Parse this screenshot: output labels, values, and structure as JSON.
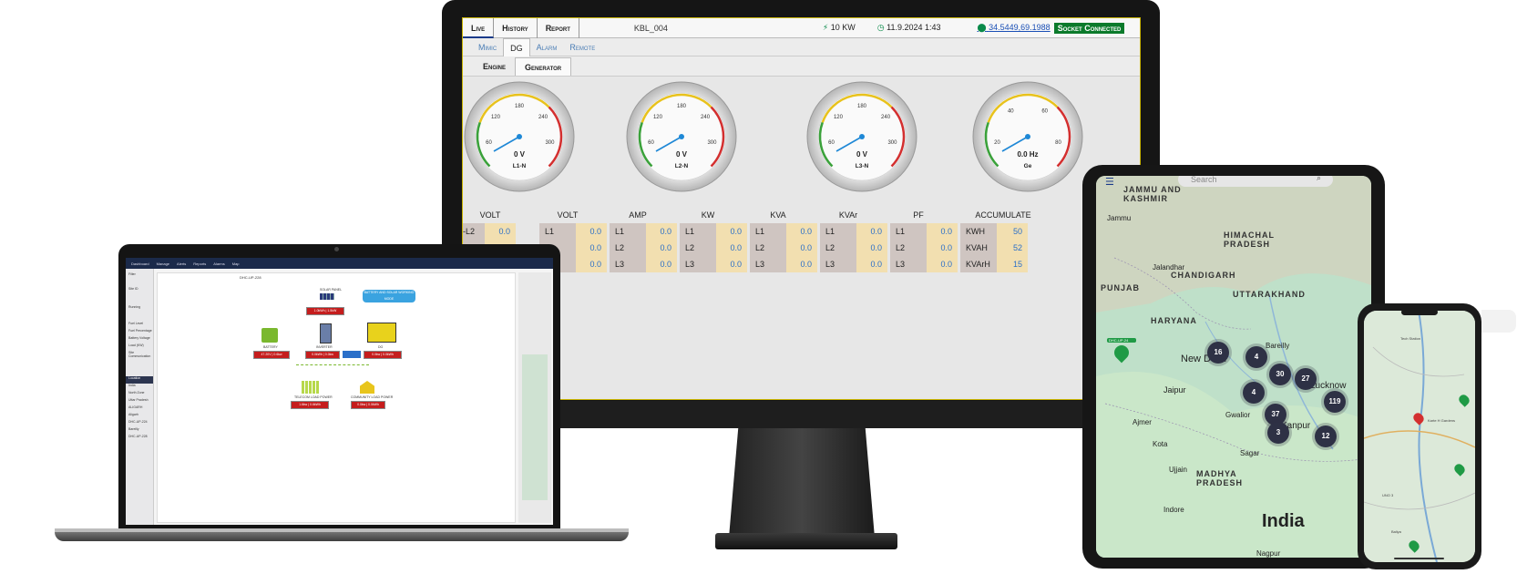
{
  "monitor": {
    "tabs": [
      "Live",
      "History",
      "Report"
    ],
    "device_id": "KBL_004",
    "power": "10 KW",
    "datetime": "11.9.2024 1:43",
    "coordinates": "34.5449,69.1988",
    "socket_status": "Socket Connected",
    "subtabs": [
      "Mimic",
      "DG",
      "Alarm",
      "Remote"
    ],
    "subtabs2": [
      "Engine",
      "Generator"
    ],
    "gauges": [
      {
        "value": "0 V",
        "label": "L1-N",
        "ticks": [
          "60",
          "120",
          "180",
          "240",
          "300"
        ]
      },
      {
        "value": "0 V",
        "label": "L2-N",
        "ticks": [
          "60",
          "120",
          "180",
          "240",
          "300"
        ]
      },
      {
        "value": "0 V",
        "label": "L3-N",
        "ticks": [
          "60",
          "120",
          "180",
          "240",
          "300"
        ]
      },
      {
        "value": "0.0 Hz",
        "label": "Ge",
        "ticks": [
          "20",
          "40",
          "60",
          "80"
        ]
      }
    ],
    "table": {
      "headers": [
        "VOLT",
        "VOLT",
        "AMP",
        "KW",
        "KVA",
        "KVAr",
        "PF",
        "ACCUMULATE"
      ],
      "groups": [
        [
          [
            "L1-L2",
            "0.0"
          ],
          [
            "L2-L3",
            "0.0"
          ],
          [
            "",
            "0.0"
          ]
        ],
        [
          [
            "L1",
            "0.0"
          ],
          [
            "L2",
            "0.0"
          ],
          [
            "L3",
            "0.0"
          ]
        ],
        [
          [
            "L1",
            "0.0"
          ],
          [
            "L2",
            "0.0"
          ],
          [
            "L3",
            "0.0"
          ]
        ],
        [
          [
            "L1",
            "0.0"
          ],
          [
            "L2",
            "0.0"
          ],
          [
            "L3",
            "0.0"
          ]
        ],
        [
          [
            "L1",
            "0.0"
          ],
          [
            "L2",
            "0.0"
          ],
          [
            "L3",
            "0.0"
          ]
        ],
        [
          [
            "L1",
            "0.0"
          ],
          [
            "L2",
            "0.0"
          ],
          [
            "L3",
            "0.0"
          ]
        ],
        [
          [
            "L1",
            "0.0"
          ],
          [
            "L2",
            "0.0"
          ],
          [
            "L3",
            "0.0"
          ]
        ],
        [
          [
            "KWH",
            "50"
          ],
          [
            "KVAH",
            "52"
          ],
          [
            "KVArH",
            "15"
          ]
        ]
      ]
    }
  },
  "laptop": {
    "nav": [
      "Dashboard",
      "Manage",
      "Alerts",
      "Reports",
      "Alarms",
      "Map"
    ],
    "sidebar": [
      "Filter",
      "Site ID",
      "Running",
      "Fuel Level",
      "Fuel Percentage",
      "Battery Voltage",
      "Load (KW)",
      "Site Communication"
    ],
    "title": "DHC-UP-228",
    "badge": "BATTERY AND SOLAR WORKING MODE",
    "solar_label": "SOLAR PANEL",
    "solar_value": "1.0kWh | 1.5kW",
    "battery_label": "BATTERY",
    "battery_value": "47.20V | 0.6kw",
    "inverter_label": "INVERTER",
    "inverter_value": "0.0kWh | 0.0kw",
    "dg_label": "DG",
    "dg_value": "0.0kw | 0.0kWh",
    "telecom_label": "TELECOM LOAD POWER",
    "telecom_value": "1.6kw | 0.6kWh",
    "community_label": "COMMUNITY LOAD POWER",
    "community_value": "0.0kw | 0.0kWh",
    "tree_title": "Location",
    "tree": [
      "India",
      "North Zone",
      "Uttar Pradesh",
      "ALIGARH",
      "Aligarh",
      "DHC-UP-224",
      "Bareilly",
      "DHC-UP-228"
    ]
  },
  "tablet": {
    "search_placeholder": "Search",
    "regions": [
      "JAMMU AND KASHMIR",
      "HIMACHAL PRADESH",
      "CHANDIGARH",
      "PUNJAB",
      "UTTARAKHAND",
      "HARYANA",
      "MADHYA PRADESH"
    ],
    "cities": [
      "Jammu",
      "Jalandhar",
      "New Delhi",
      "Jaipur",
      "Ajmer",
      "Kota",
      "Gwalior",
      "Lucknow",
      "Kanpur",
      "Ujjain",
      "Sagar",
      "Indore",
      "Bareilly",
      "Nagpur"
    ],
    "clusters": [
      "16",
      "4",
      "30",
      "27",
      "4",
      "37",
      "119",
      "3",
      "12"
    ],
    "country": "India",
    "pin_label": "DHC-UP-24"
  },
  "phone": {
    "labels": [
      "Tech Station",
      "Karte H Gardens",
      "UNO 3",
      "Baliya"
    ]
  }
}
